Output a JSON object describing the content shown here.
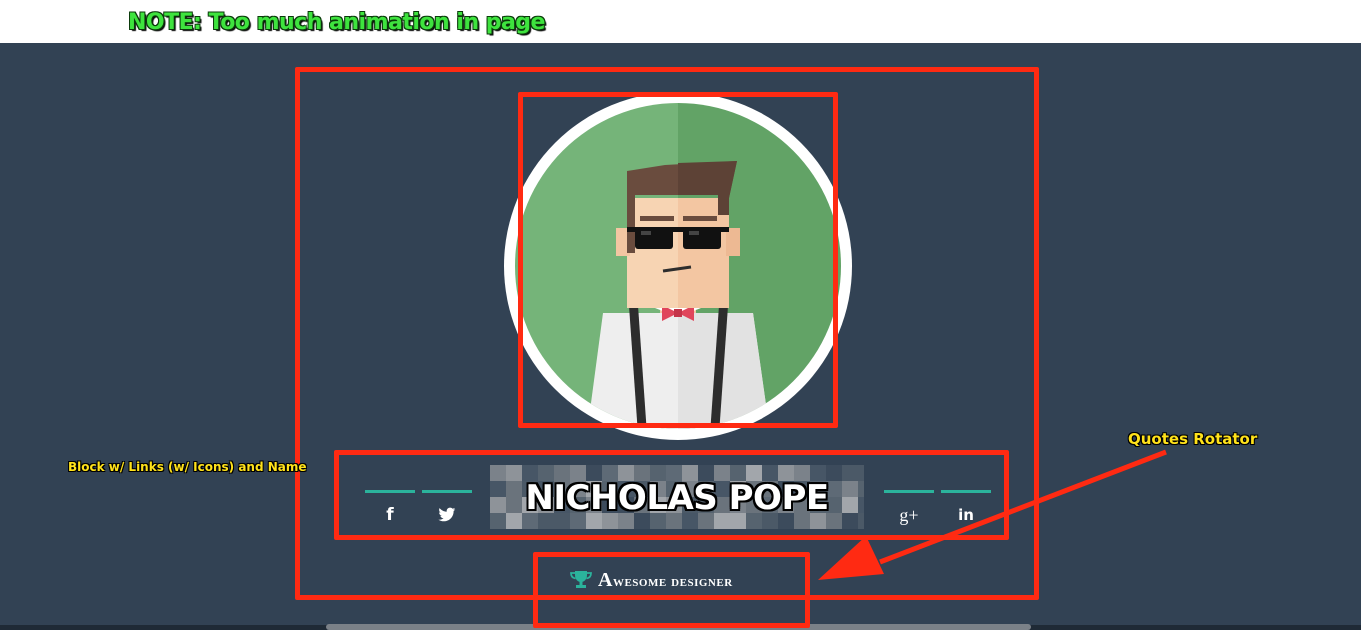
{
  "annotations": {
    "note": "NOTE: Too much animation in page",
    "links_block": "Block w/ Links (w/ Icons) and Name",
    "quotes_rotator": "Quotes Rotator"
  },
  "profile": {
    "name": "NICHOLAS POPE",
    "quote": "Awesome designer",
    "quote_icon": "trophy-icon"
  },
  "social_links": [
    {
      "icon": "facebook-icon",
      "glyph": "f"
    },
    {
      "icon": "twitter-icon",
      "glyph": "t"
    },
    {
      "icon": "google-plus-icon",
      "glyph": "g+"
    },
    {
      "icon": "linkedin-icon",
      "glyph": "in"
    }
  ],
  "colors": {
    "page_bg": "#324254",
    "accent_teal": "#2bb39c",
    "avatar_green": "#67a86b",
    "annotation_red": "#ff2a12",
    "annotation_yellow": "#ffe21a",
    "annotation_green": "#3ee33e"
  }
}
